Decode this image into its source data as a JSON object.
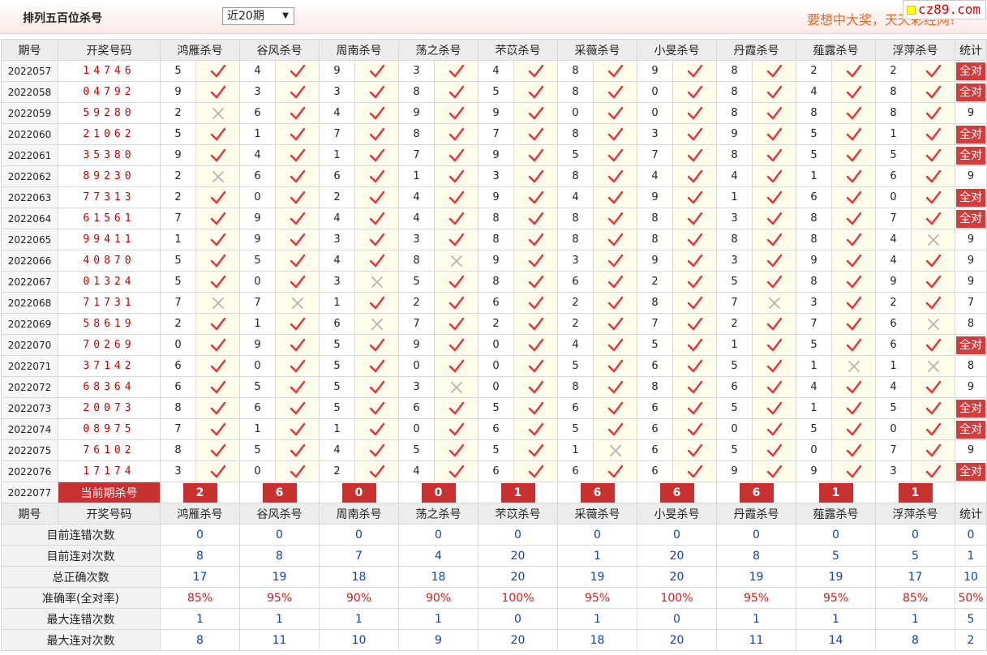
{
  "header": {
    "title": "排列五百位杀号",
    "period_select": "近20期",
    "slogan": "要想中大奖，天天彩经网!",
    "site": "cz89.com"
  },
  "columns": {
    "issue": "期号",
    "draw": "开奖号码",
    "experts": [
      "鸿雁杀号",
      "谷风杀号",
      "周南杀号",
      "荡之杀号",
      "芣苡杀号",
      "采薇杀号",
      "小旻杀号",
      "丹霞杀号",
      "薤露杀号",
      "浮萍杀号"
    ],
    "stats": "统计"
  },
  "rows": [
    {
      "issue": "2022057",
      "draw": "14746",
      "picks": [
        5,
        4,
        9,
        3,
        4,
        8,
        9,
        8,
        2,
        2
      ],
      "ok": [
        1,
        1,
        1,
        1,
        1,
        1,
        1,
        1,
        1,
        1
      ],
      "stat": "全对"
    },
    {
      "issue": "2022058",
      "draw": "04792",
      "picks": [
        9,
        3,
        3,
        8,
        5,
        8,
        0,
        8,
        4,
        8
      ],
      "ok": [
        1,
        1,
        1,
        1,
        1,
        1,
        1,
        1,
        1,
        1
      ],
      "stat": "全对"
    },
    {
      "issue": "2022059",
      "draw": "59280",
      "picks": [
        2,
        6,
        4,
        9,
        9,
        0,
        0,
        8,
        8,
        8
      ],
      "ok": [
        0,
        1,
        1,
        1,
        1,
        1,
        1,
        1,
        1,
        1
      ],
      "stat": "9"
    },
    {
      "issue": "2022060",
      "draw": "21062",
      "picks": [
        5,
        1,
        7,
        8,
        7,
        8,
        3,
        9,
        5,
        1
      ],
      "ok": [
        1,
        1,
        1,
        1,
        1,
        1,
        1,
        1,
        1,
        1
      ],
      "stat": "全对"
    },
    {
      "issue": "2022061",
      "draw": "35380",
      "picks": [
        9,
        4,
        1,
        7,
        9,
        5,
        7,
        8,
        5,
        5
      ],
      "ok": [
        1,
        1,
        1,
        1,
        1,
        1,
        1,
        1,
        1,
        1
      ],
      "stat": "全对"
    },
    {
      "issue": "2022062",
      "draw": "89230",
      "picks": [
        2,
        6,
        6,
        1,
        3,
        8,
        4,
        4,
        1,
        6
      ],
      "ok": [
        0,
        1,
        1,
        1,
        1,
        1,
        1,
        1,
        1,
        1
      ],
      "stat": "9"
    },
    {
      "issue": "2022063",
      "draw": "77313",
      "picks": [
        2,
        0,
        2,
        4,
        9,
        4,
        9,
        1,
        6,
        0
      ],
      "ok": [
        1,
        1,
        1,
        1,
        1,
        1,
        1,
        1,
        1,
        1
      ],
      "stat": "全对"
    },
    {
      "issue": "2022064",
      "draw": "61561",
      "picks": [
        7,
        9,
        4,
        4,
        8,
        8,
        8,
        3,
        8,
        7
      ],
      "ok": [
        1,
        1,
        1,
        1,
        1,
        1,
        1,
        1,
        1,
        1
      ],
      "stat": "全对"
    },
    {
      "issue": "2022065",
      "draw": "99411",
      "picks": [
        1,
        9,
        3,
        3,
        8,
        8,
        8,
        8,
        8,
        4
      ],
      "ok": [
        1,
        1,
        1,
        1,
        1,
        1,
        1,
        1,
        1,
        0
      ],
      "stat": "9"
    },
    {
      "issue": "2022066",
      "draw": "40870",
      "picks": [
        5,
        5,
        4,
        8,
        9,
        3,
        9,
        3,
        9,
        4
      ],
      "ok": [
        1,
        1,
        1,
        0,
        1,
        1,
        1,
        1,
        1,
        1
      ],
      "stat": "9"
    },
    {
      "issue": "2022067",
      "draw": "01324",
      "picks": [
        5,
        0,
        3,
        5,
        8,
        6,
        2,
        5,
        8,
        9
      ],
      "ok": [
        1,
        1,
        0,
        1,
        1,
        1,
        1,
        1,
        1,
        1
      ],
      "stat": "9"
    },
    {
      "issue": "2022068",
      "draw": "71731",
      "picks": [
        7,
        7,
        1,
        2,
        6,
        2,
        8,
        7,
        3,
        2
      ],
      "ok": [
        0,
        0,
        1,
        1,
        1,
        1,
        1,
        0,
        1,
        1
      ],
      "stat": "7"
    },
    {
      "issue": "2022069",
      "draw": "58619",
      "picks": [
        2,
        1,
        6,
        7,
        2,
        2,
        7,
        2,
        7,
        6
      ],
      "ok": [
        1,
        1,
        0,
        1,
        1,
        1,
        1,
        1,
        1,
        0
      ],
      "stat": "8"
    },
    {
      "issue": "2022070",
      "draw": "70269",
      "picks": [
        0,
        9,
        5,
        9,
        0,
        4,
        5,
        1,
        5,
        6
      ],
      "ok": [
        1,
        1,
        1,
        1,
        1,
        1,
        1,
        1,
        1,
        1
      ],
      "stat": "全对"
    },
    {
      "issue": "2022071",
      "draw": "37142",
      "picks": [
        6,
        0,
        5,
        0,
        0,
        5,
        6,
        5,
        1,
        1
      ],
      "ok": [
        1,
        1,
        1,
        1,
        1,
        1,
        1,
        1,
        0,
        0
      ],
      "stat": "8"
    },
    {
      "issue": "2022072",
      "draw": "68364",
      "picks": [
        6,
        5,
        5,
        3,
        0,
        8,
        8,
        6,
        4,
        4
      ],
      "ok": [
        1,
        1,
        1,
        0,
        1,
        1,
        1,
        1,
        1,
        1
      ],
      "stat": "9"
    },
    {
      "issue": "2022073",
      "draw": "20073",
      "picks": [
        8,
        6,
        5,
        6,
        5,
        6,
        6,
        5,
        1,
        5
      ],
      "ok": [
        1,
        1,
        1,
        1,
        1,
        1,
        1,
        1,
        1,
        1
      ],
      "stat": "全对"
    },
    {
      "issue": "2022074",
      "draw": "08975",
      "picks": [
        7,
        1,
        1,
        0,
        6,
        5,
        6,
        0,
        5,
        0
      ],
      "ok": [
        1,
        1,
        1,
        1,
        1,
        1,
        1,
        1,
        1,
        1
      ],
      "stat": "全对"
    },
    {
      "issue": "2022075",
      "draw": "76102",
      "picks": [
        8,
        5,
        4,
        5,
        5,
        1,
        6,
        5,
        0,
        7
      ],
      "ok": [
        1,
        1,
        1,
        1,
        1,
        0,
        1,
        1,
        1,
        1
      ],
      "stat": "9"
    },
    {
      "issue": "2022076",
      "draw": "17174",
      "picks": [
        3,
        0,
        2,
        4,
        6,
        6,
        6,
        9,
        9,
        3
      ],
      "ok": [
        1,
        1,
        1,
        1,
        1,
        1,
        1,
        1,
        1,
        1
      ],
      "stat": "全对"
    }
  ],
  "current": {
    "issue": "2022077",
    "label": "当前期杀号",
    "picks": [
      "2",
      "6",
      "0",
      "0",
      "1",
      "6",
      "6",
      "6",
      "1",
      "1"
    ]
  },
  "summary": [
    {
      "label": "目前连错次数",
      "values": [
        "0",
        "0",
        "0",
        "0",
        "0",
        "0",
        "0",
        "0",
        "0",
        "0",
        "0"
      ]
    },
    {
      "label": "目前连对次数",
      "values": [
        "8",
        "8",
        "7",
        "4",
        "20",
        "1",
        "20",
        "8",
        "5",
        "5",
        "1"
      ]
    },
    {
      "label": "总正确次数",
      "values": [
        "17",
        "19",
        "18",
        "18",
        "20",
        "19",
        "20",
        "19",
        "19",
        "17",
        "10"
      ]
    },
    {
      "label": "准确率(全对率)",
      "values": [
        "85%",
        "95%",
        "90%",
        "90%",
        "100%",
        "95%",
        "100%",
        "95%",
        "95%",
        "85%",
        "50%"
      ],
      "pct": true
    },
    {
      "label": "最大连错次数",
      "values": [
        "1",
        "1",
        "1",
        "1",
        "0",
        "1",
        "0",
        "1",
        "1",
        "1",
        "5"
      ]
    },
    {
      "label": "最大连对次数",
      "values": [
        "8",
        "11",
        "10",
        "9",
        "20",
        "18",
        "20",
        "11",
        "14",
        "8",
        "2"
      ]
    }
  ],
  "icons": {
    "correct": "check-icon",
    "wrong": "cross-icon"
  },
  "colors": {
    "check": "#e8323a",
    "cross": "#b5b5b5",
    "accent": "#c8312f",
    "blue": "#1542b0"
  }
}
